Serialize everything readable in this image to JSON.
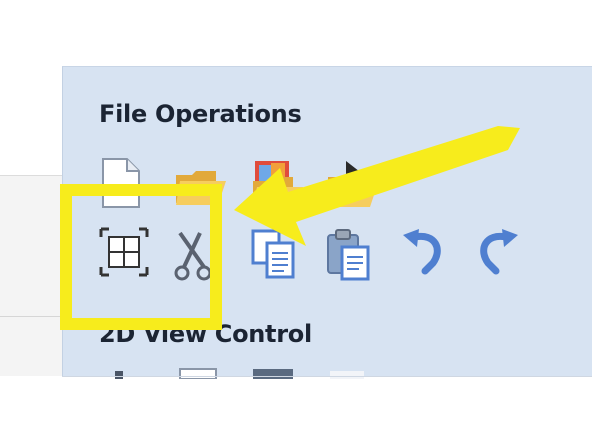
{
  "ribbon": {
    "sections": {
      "file_operations": {
        "title": "File Operations",
        "tools": [
          {
            "icon": "new-file-icon"
          },
          {
            "icon": "open-folder-icon"
          },
          {
            "icon": "import-image-icon"
          },
          {
            "icon": "save-folder-icon"
          }
        ],
        "edit_tools": [
          {
            "icon": "select-bounds-icon",
            "highlighted": true
          },
          {
            "icon": "cut-scissors-icon"
          },
          {
            "icon": "copy-icon"
          },
          {
            "icon": "paste-icon"
          },
          {
            "icon": "undo-icon"
          },
          {
            "icon": "redo-icon"
          }
        ]
      },
      "view_control": {
        "title": "2D View Control"
      }
    }
  },
  "annotation": {
    "highlight_color": "#f7ec1c",
    "arrow_color": "#f7ec1c"
  },
  "colors": {
    "panel_bg": "#d7e3f2",
    "icon_blue": "#4f7fd0",
    "icon_folder": "#f2c450"
  }
}
